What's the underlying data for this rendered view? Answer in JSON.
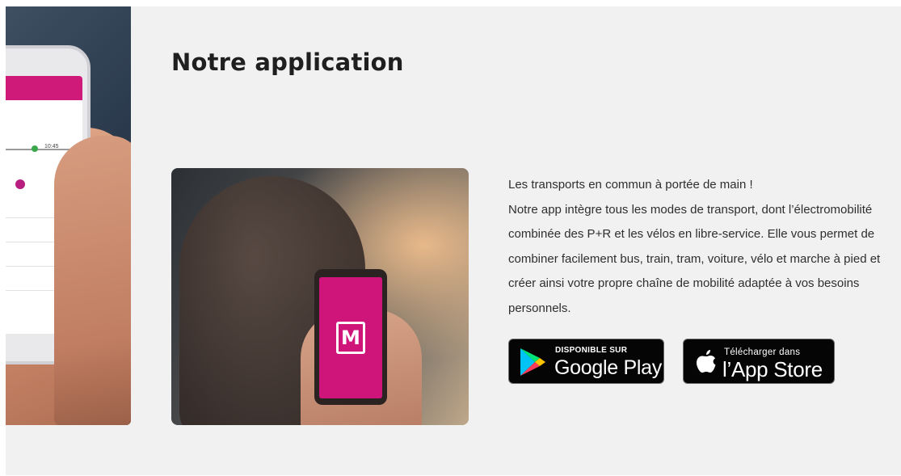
{
  "section": {
    "title": "Notre application",
    "description_lines": [
      "Les transports en commun à portée de main !",
      "Notre app intègre tous les modes de transport, dont l’électromobilité",
      "combinée des P+R et les vélos en libre-service. Elle vous permet de",
      "combiner facilement bus, train, tram, voiture, vélo et marche à pied et",
      "créer ainsi votre propre chaîne de mobilité adaptée à vos besoins",
      "personnels."
    ]
  },
  "left_photo": {
    "screen_time": "10:45"
  },
  "stores": {
    "google_play": {
      "small": "DISPONIBLE SUR",
      "big": "Google Play",
      "icon": "google-play-icon"
    },
    "app_store": {
      "small": "Télécharger dans",
      "big": "l’App Store",
      "icon": "apple-icon"
    }
  },
  "colors": {
    "brand": "#d0157a",
    "background": "#f1f1f1",
    "badge": "#050505"
  },
  "app_logo": {
    "glyph": "M"
  }
}
